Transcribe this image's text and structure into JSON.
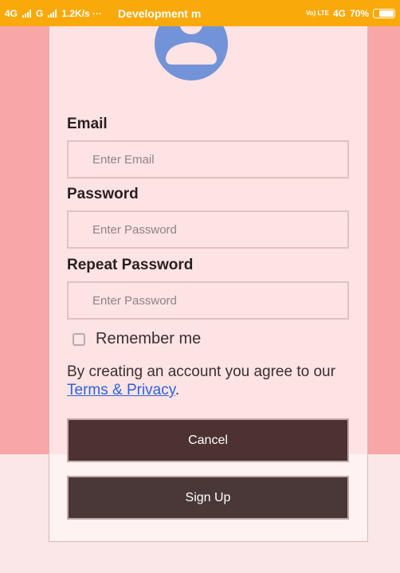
{
  "status_bar": {
    "network1": "4G",
    "network2": "G",
    "speed": "1.2K/s ···",
    "app_title": "Development m",
    "volte": "Vo) LTE",
    "network3": "4G",
    "battery": "70%"
  },
  "form": {
    "email_label": "Email",
    "email_placeholder": "Enter Email",
    "password_label": "Password",
    "password_placeholder": "Enter Password",
    "repeat_label": "Repeat Password",
    "repeat_placeholder": "Enter Password",
    "remember_label": "Remember me",
    "remember_checked": false,
    "terms_prefix": "By creating an account you agree to our ",
    "terms_link": "Terms & Privacy",
    "terms_suffix": ".",
    "cancel_label": "Cancel",
    "signup_label": "Sign Up"
  },
  "icons": {
    "avatar": "user-avatar-icon"
  },
  "colors": {
    "status_bar": "#f9a90a",
    "page_top": "#f6a7a6",
    "card": "#fde3e3",
    "button": "#4d3232",
    "link": "#2f62d8",
    "avatar": "#7393d8"
  }
}
